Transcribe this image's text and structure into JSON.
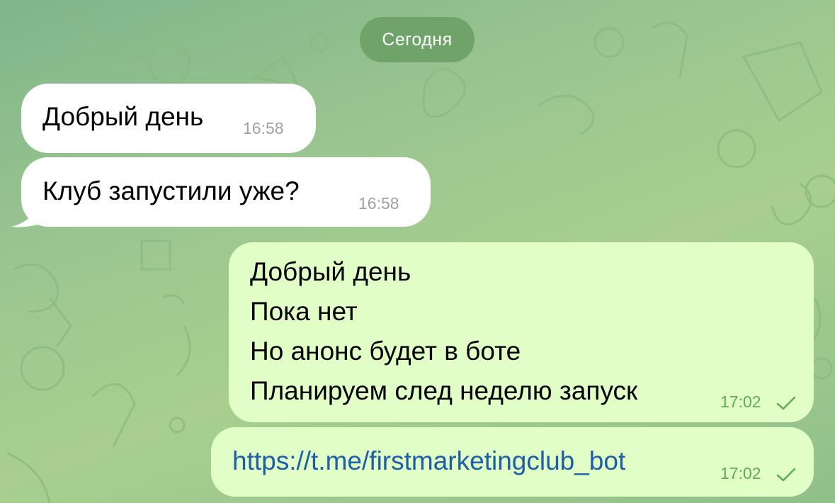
{
  "date_separator": "Сегодня",
  "messages": [
    {
      "direction": "incoming",
      "text": "Добрый день",
      "time": "16:58"
    },
    {
      "direction": "incoming",
      "text": "Клуб запустили уже?",
      "time": "16:58"
    },
    {
      "direction": "outgoing",
      "text": "Добрый день\nПока нет\nНо анонс будет в боте\nПланируем след неделю запуск",
      "time": "17:02",
      "status": "sent-check"
    },
    {
      "direction": "outgoing",
      "text": "https://t.me/firstmarketingclub_bot",
      "time": "17:02",
      "status": "sent-check",
      "is_link": true
    }
  ],
  "colors": {
    "background": "#9cc690",
    "incoming_bubble": "#ffffff",
    "outgoing_bubble": "#e1fec6",
    "date_pill": "#6fa36a",
    "link": "#1c5ea8",
    "outgoing_time": "#62a95f"
  }
}
